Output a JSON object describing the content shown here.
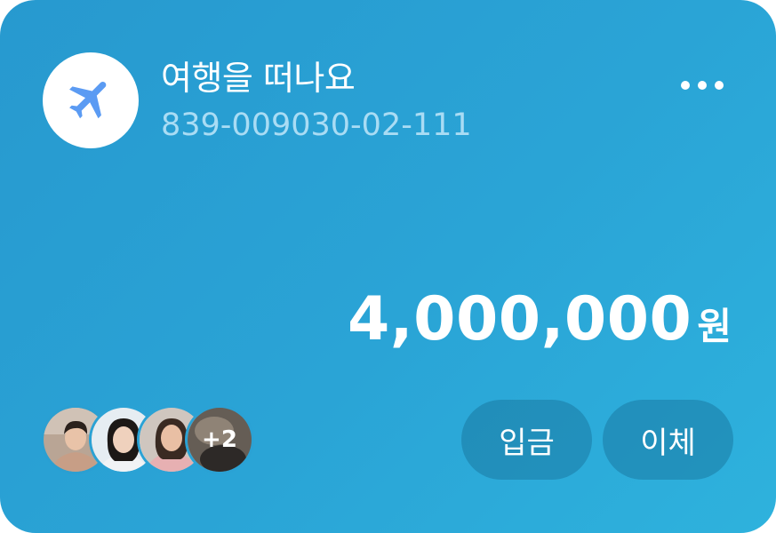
{
  "account": {
    "icon": "airplane-icon",
    "name": "여행을 떠나요",
    "number": "839-009030-02-111"
  },
  "more_menu": {
    "icon": "more-horizontal-icon"
  },
  "balance": {
    "amount": "4,000,000",
    "unit": "원"
  },
  "members": {
    "extra_count_label": "+2"
  },
  "actions": {
    "deposit_label": "입금",
    "transfer_label": "이체"
  },
  "colors": {
    "card_gradient_start": "#2799cf",
    "card_gradient_end": "#2eb2dd",
    "account_number": "#a9dcf4",
    "icon_blue": "#5b9bf3"
  }
}
